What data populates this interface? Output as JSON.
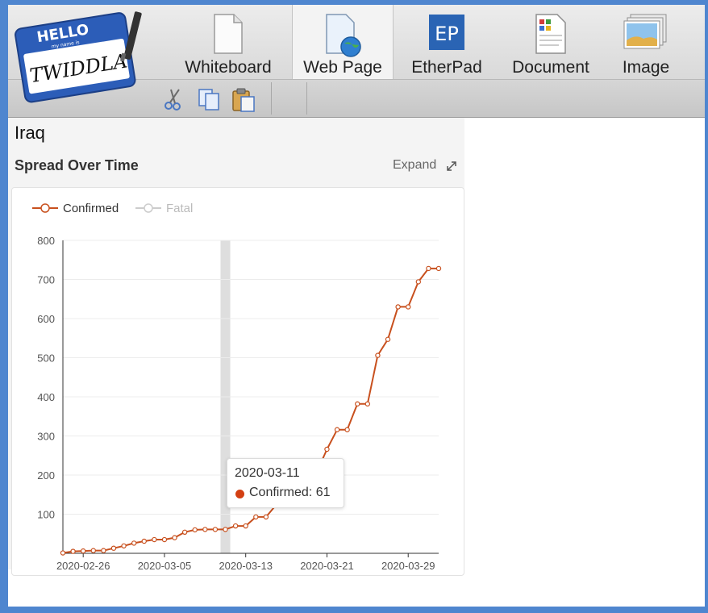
{
  "app": {
    "logo_top": "HELLO",
    "logo_sub": "my name is",
    "logo_main": "TWIDDLA"
  },
  "toolbar": {
    "tabs": [
      {
        "label": "Whiteboard",
        "icon": "blank-page-icon"
      },
      {
        "label": "Web Page",
        "icon": "web-page-globe-icon",
        "active": true
      },
      {
        "label": "EtherPad",
        "icon": "etherpad-icon",
        "icon_text": "EP"
      },
      {
        "label": "Document",
        "icon": "document-icon"
      },
      {
        "label": "Image",
        "icon": "image-icon"
      }
    ],
    "edit_tools": [
      "cut-icon",
      "copy-icon",
      "paste-icon"
    ]
  },
  "page": {
    "country": "Iraq",
    "section_title": "Spread Over Time",
    "expand_label": "Expand"
  },
  "colors": {
    "confirmed": "#c8501e",
    "fatal_legend": "#cccccc",
    "highlight_band": "#dedede",
    "frame": "#4f86cf"
  },
  "tooltip": {
    "date": "2020-03-11",
    "series": "Confirmed",
    "value": 61,
    "text": "Confirmed: 61"
  },
  "chart_data": {
    "type": "line",
    "legend": [
      {
        "name": "Confirmed",
        "color": "#c8501e",
        "active": true
      },
      {
        "name": "Fatal",
        "color": "#cccccc",
        "active": false
      }
    ],
    "legend_position": "top-left",
    "ylim": [
      0,
      800
    ],
    "yticks": [
      "100",
      "200",
      "300",
      "400",
      "500",
      "600",
      "700",
      "800"
    ],
    "xticks": [
      "2020-02-26",
      "2020-03-05",
      "2020-03-13",
      "2020-03-21",
      "2020-03-29"
    ],
    "grid": "horizontal",
    "highlighted_date": "2020-03-11",
    "series": [
      {
        "name": "Confirmed",
        "x": [
          "2020-02-24",
          "2020-02-25",
          "2020-02-26",
          "2020-02-27",
          "2020-02-28",
          "2020-02-29",
          "2020-03-01",
          "2020-03-02",
          "2020-03-03",
          "2020-03-04",
          "2020-03-05",
          "2020-03-06",
          "2020-03-07",
          "2020-03-08",
          "2020-03-09",
          "2020-03-10",
          "2020-03-11",
          "2020-03-12",
          "2020-03-13",
          "2020-03-14",
          "2020-03-15",
          "2020-03-16",
          "2020-03-17",
          "2020-03-18",
          "2020-03-19",
          "2020-03-20",
          "2020-03-21",
          "2020-03-22",
          "2020-03-23",
          "2020-03-24",
          "2020-03-25",
          "2020-03-26",
          "2020-03-27",
          "2020-03-28",
          "2020-03-29",
          "2020-03-30",
          "2020-03-31",
          "2020-04-01"
        ],
        "values": [
          1,
          5,
          6,
          7,
          7,
          13,
          19,
          26,
          31,
          35,
          35,
          40,
          54,
          60,
          61,
          61,
          61,
          70,
          70,
          93,
          93,
          124,
          154,
          164,
          192,
          208,
          266,
          316,
          316,
          382,
          382,
          506,
          547,
          630,
          630,
          694,
          728,
          728
        ]
      }
    ]
  }
}
